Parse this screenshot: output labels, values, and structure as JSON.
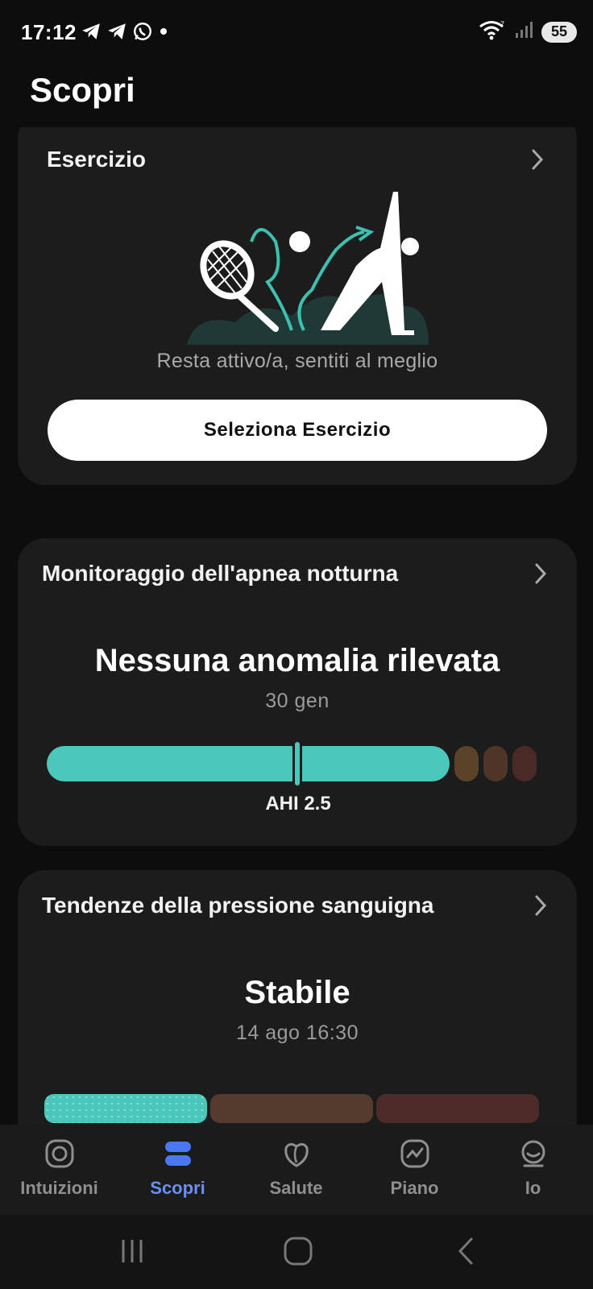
{
  "status_bar": {
    "time": "17:12",
    "battery": "55"
  },
  "page": {
    "title": "Scopri"
  },
  "exercise_card": {
    "title": "Esercizio",
    "subtitle": "Resta attivo/a, sentiti al meglio",
    "button_label": "Seleziona Esercizio"
  },
  "apnea_card": {
    "title": "Monitoraggio dell'apnea notturna",
    "status": "Nessuna anomalia rilevata",
    "date": "30 gen",
    "ahi_label": "AHI 2.5",
    "ahi_value": 2.5,
    "colors": {
      "normal": "#4cc7bb",
      "mild": "#5a4326",
      "moderate": "#4f3528",
      "severe": "#4a2a26"
    }
  },
  "bp_card": {
    "title": "Tendenze della pressione sanguigna",
    "status": "Stabile",
    "date": "14 ago 16:30",
    "colors": {
      "stable": "#4cc7bb",
      "middle": "#553b2d",
      "high": "#4d2b28"
    }
  },
  "bottom_nav": {
    "items": [
      {
        "label": "Intuizioni",
        "icon": "circle-ring-icon"
      },
      {
        "label": "Scopri",
        "icon": "discover-pills-icon",
        "active": true
      },
      {
        "label": "Salute",
        "icon": "health-leaf-icon"
      },
      {
        "label": "Piano",
        "icon": "plan-chart-icon"
      },
      {
        "label": "Io",
        "icon": "profile-face-icon"
      }
    ],
    "active_color": "#6b8ff0"
  },
  "system_nav": {
    "icons": [
      "recent-apps-icon",
      "home-icon",
      "back-icon"
    ]
  }
}
